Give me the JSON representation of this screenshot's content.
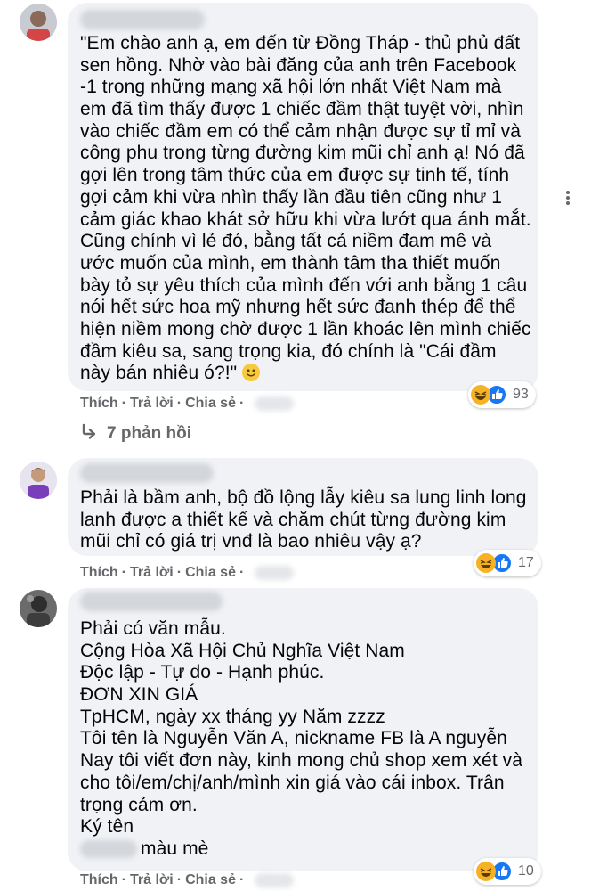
{
  "comments": [
    {
      "lines": [
        "\"Em chào anh ạ, em đến từ Đồng Tháp - thủ phủ đất",
        "sen hồng. Nhờ vào bài đăng của anh trên Facebook",
        "-1 trong những mạng xã hội lớn nhất Việt Nam mà",
        "em đã tìm thấy được 1 chiếc đầm thật tuyệt vời, nhìn",
        "vào chiếc đầm em có thể cảm nhận được sự tỉ mỉ và",
        "công phu trong từng đường kim mũi chỉ anh ạ! Nó đã",
        "gợi lên trong tâm thức của em được sự tinh tế, tính",
        "gợi cảm khi vừa nhìn thấy lần đầu tiên cũng như 1",
        "cảm giác khao khát sở hữu khi vừa lướt qua ánh mắt.",
        "Cũng chính vì lẻ đó, bằng tất cả niềm đam mê và",
        "ước muốn của mình, em thành tâm tha thiết muốn",
        "bày tỏ sự yêu thích của mình đến với anh bằng 1 câu",
        "nói hết sức hoa mỹ nhưng hết sức đanh thép để thể",
        "hiện niềm mong chờ được 1 lần khoác lên mình chiếc",
        "đầm kiêu sa, sang trọng kia, đó chính là \"Cái đầm",
        "này bán nhiêu ó?!\""
      ],
      "reaction_count": "93"
    },
    {
      "lines": [
        "Phải là bầm anh, bộ đồ lộng lẫy kiêu sa lung linh long",
        "lanh được a thiết kế và chăm chút từng đường kim",
        "mũi chỉ có giá trị vnđ là bao nhiêu vậy ạ?"
      ],
      "reaction_count": "17"
    },
    {
      "lines": [
        "Phải có văn mẫu.",
        "Cộng Hòa Xã Hội Chủ Nghĩa Việt Nam",
        "Độc lập - Tự do - Hạnh phúc.",
        "ĐƠN XIN GIÁ",
        "TpHCM, ngày xx tháng yy Năm zzzz",
        "Tôi tên là Nguyễn Văn A, nickname FB là A nguyễn",
        "Nay tôi viết đơn này, kinh mong chủ shop xem xét và",
        "cho tôi/em/chị/anh/mình xin giá vào cái inbox. Trân",
        "trọng cảm ơn.",
        "Ký tên"
      ],
      "signature": "màu mè",
      "reaction_count": "10"
    }
  ],
  "actions": {
    "like": "Thích",
    "reply": "Trả lời",
    "share": "Chia sẻ",
    "dot": "·"
  },
  "replies_label": "7 phản hồi",
  "icons": {
    "more": "more-options-icon",
    "reply_arrow": "reply-arrow-icon",
    "haha": "haha-reaction-icon",
    "like": "like-reaction-icon",
    "smile": "smile-emoji-icon"
  },
  "colors": {
    "bubble": "#f0f2f5",
    "meta": "#65676b",
    "like_blue": "#1877f2",
    "haha_yellow": "#f7b125"
  }
}
